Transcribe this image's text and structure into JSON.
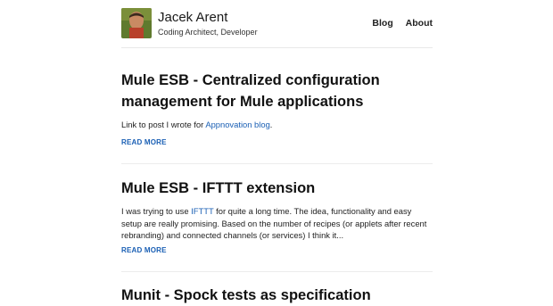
{
  "site": {
    "name": "Jacek Arent",
    "tagline": "Coding Architect, Developer"
  },
  "nav": {
    "items": [
      "Blog",
      "About"
    ]
  },
  "posts": [
    {
      "title_line1": "Mule ESB - Centralized configuration",
      "title_line2": "management for Mule applications",
      "excerpt_before": "Link to post I wrote for ",
      "excerpt_link": "Appnovation blog",
      "excerpt_after": ".",
      "read_more": "READ MORE"
    },
    {
      "title_line1": "Mule ESB - IFTTT extension",
      "excerpt_before": "I was trying to use ",
      "excerpt_link": "IFTTT",
      "excerpt_after": " for quite a long time. The idea, functionality and easy setup are really promising. Based on the number of recipes (or applets after recent rebranding) and connected channels (or services) I think it...",
      "read_more": "READ MORE"
    },
    {
      "title_line1": "Munit - Spock tests as specification"
    }
  ],
  "colors": {
    "link": "#1a5fb4",
    "text": "#111111",
    "rule": "#ececec"
  }
}
